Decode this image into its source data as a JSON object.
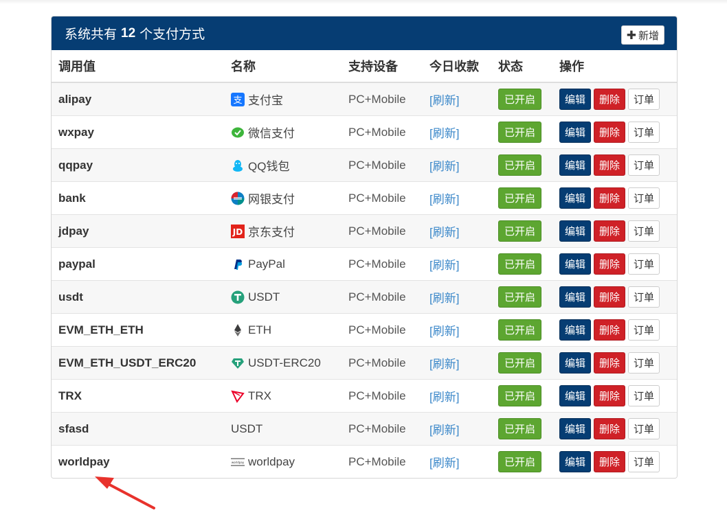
{
  "header": {
    "title_prefix": "系统共有",
    "count": "12",
    "title_suffix": "个支付方式",
    "add_label": "新增"
  },
  "columns": [
    "调用值",
    "名称",
    "支持设备",
    "今日收款",
    "状态",
    "操作"
  ],
  "rows": [
    {
      "code": "alipay",
      "name": "支付宝",
      "icon": "alipay-icon",
      "device": "PC+Mobile",
      "today": "[刷新]",
      "status": "已开启"
    },
    {
      "code": "wxpay",
      "name": "微信支付",
      "icon": "wechat-icon",
      "device": "PC+Mobile",
      "today": "[刷新]",
      "status": "已开启"
    },
    {
      "code": "qqpay",
      "name": "QQ钱包",
      "icon": "qq-icon",
      "device": "PC+Mobile",
      "today": "[刷新]",
      "status": "已开启"
    },
    {
      "code": "bank",
      "name": "网银支付",
      "icon": "unionpay-icon",
      "device": "PC+Mobile",
      "today": "[刷新]",
      "status": "已开启"
    },
    {
      "code": "jdpay",
      "name": "京东支付",
      "icon": "jd-icon",
      "device": "PC+Mobile",
      "today": "[刷新]",
      "status": "已开启"
    },
    {
      "code": "paypal",
      "name": "PayPal",
      "icon": "paypal-icon",
      "device": "PC+Mobile",
      "today": "[刷新]",
      "status": "已开启"
    },
    {
      "code": "usdt",
      "name": "USDT",
      "icon": "tether-icon",
      "device": "PC+Mobile",
      "today": "[刷新]",
      "status": "已开启"
    },
    {
      "code": "EVM_ETH_ETH",
      "name": "ETH",
      "icon": "ethereum-icon",
      "device": "PC+Mobile",
      "today": "[刷新]",
      "status": "已开启"
    },
    {
      "code": "EVM_ETH_USDT_ERC20",
      "name": "USDT-ERC20",
      "icon": "tether-diamond-icon",
      "device": "PC+Mobile",
      "today": "[刷新]",
      "status": "已开启"
    },
    {
      "code": "TRX",
      "name": "TRX",
      "icon": "tron-icon",
      "device": "PC+Mobile",
      "today": "[刷新]",
      "status": "已开启"
    },
    {
      "code": "sfasd",
      "name": "USDT",
      "icon": "",
      "device": "PC+Mobile",
      "today": "[刷新]",
      "status": "已开启"
    },
    {
      "code": "worldpay",
      "name": "worldpay",
      "icon": "worldpay-icon",
      "device": "PC+Mobile",
      "today": "[刷新]",
      "status": "已开启"
    }
  ],
  "actions": {
    "edit": "编辑",
    "delete": "删除",
    "orders": "订单"
  },
  "colors": {
    "header_bg": "#063d73",
    "status_green": "#5da631",
    "delete_red": "#cf2127",
    "link_blue": "#3a87c9",
    "arrow_red": "#e8322c"
  }
}
